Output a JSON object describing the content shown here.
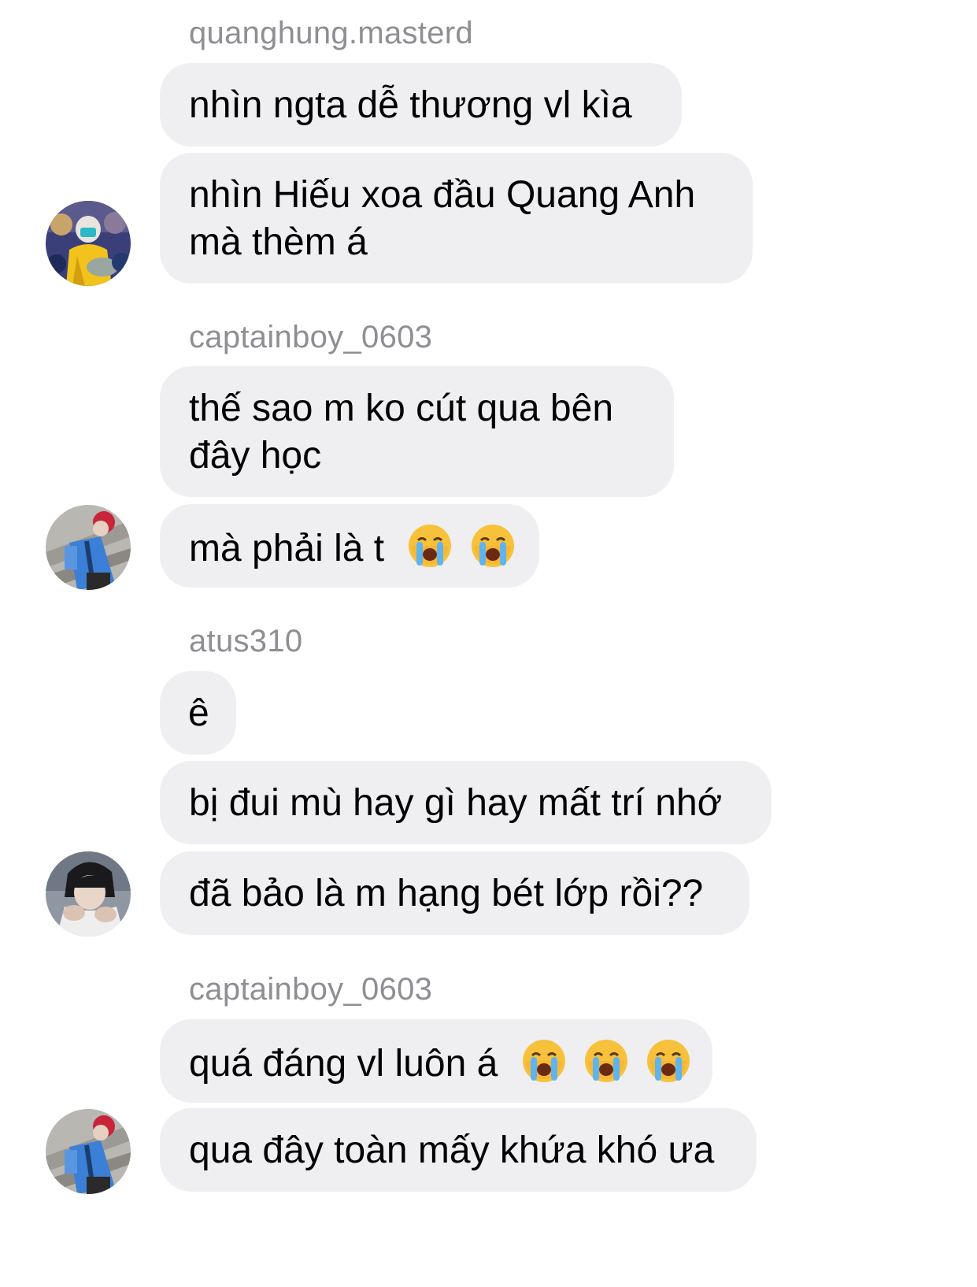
{
  "groups": [
    {
      "sender": "quanghung.masterd",
      "avatar": "avatar-yellow-outfit",
      "messages": [
        {
          "text": "nhìn ngta dễ thương vl kìa",
          "emoji_count": 0
        },
        {
          "text_line1": "nhìn Hiếu xoa đầu Quang Anh",
          "text_line2": "mà thèm á",
          "emoji_count": 0
        }
      ]
    },
    {
      "sender": "captainboy_0603",
      "avatar": "avatar-blue-jacket",
      "messages": [
        {
          "text_line1": "thế sao m ko cút qua bên",
          "text_line2": "đây học",
          "emoji_count": 0
        },
        {
          "text": "mà phải là t",
          "emoji_count": 2,
          "emoji": "loudly-crying-face-icon"
        }
      ]
    },
    {
      "sender": "atus310",
      "avatar": "avatar-dark-portrait",
      "messages": [
        {
          "text": "ê",
          "emoji_count": 0
        },
        {
          "text": "bị đui mù hay gì hay mất trí nhớ",
          "emoji_count": 0
        },
        {
          "text": "đã bảo là m hạng bét lớp rồi??",
          "emoji_count": 0
        }
      ]
    },
    {
      "sender": "captainboy_0603",
      "avatar": "avatar-blue-jacket",
      "messages": [
        {
          "text": "quá đáng vl luôn á",
          "emoji_count": 3,
          "emoji": "loudly-crying-face-icon"
        },
        {
          "text": "qua đây toàn mấy khứa khó ưa",
          "emoji_count": 0
        }
      ]
    }
  ],
  "colors": {
    "bubble": "#efeff1",
    "sender": "#8e8e93",
    "text": "#000000",
    "background": "#ffffff"
  }
}
